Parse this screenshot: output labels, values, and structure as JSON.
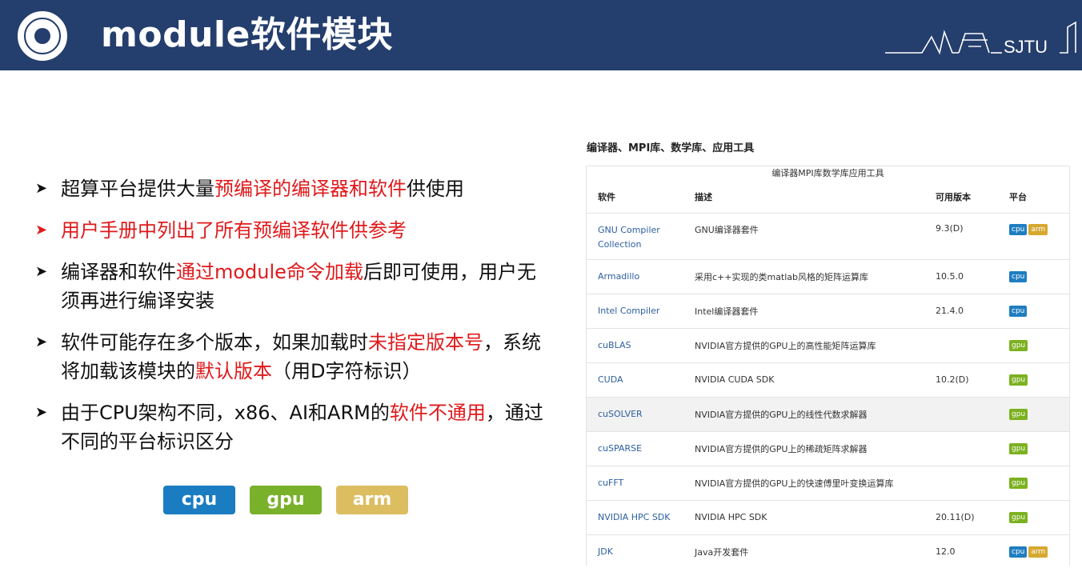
{
  "header": {
    "title": "module软件模块",
    "brand_text": "SJTU"
  },
  "bullets": [
    {
      "parts": [
        "超算平台提供大量",
        "预编译的编译器和软件",
        "供使用"
      ],
      "red": [
        false,
        true,
        false
      ]
    },
    {
      "parts": [
        "用户手册",
        "中列出了所有预编译软件供参考"
      ],
      "red": [
        true,
        false
      ]
    },
    {
      "parts": [
        "编译器和软件",
        "通过module命令加载",
        "后即可使用，用户无须再进行编译安装"
      ],
      "red": [
        false,
        true,
        false
      ]
    },
    {
      "parts": [
        "软件可能存在多个版本，如果加载时",
        "未指定版本号",
        "，系统将加载该模块的",
        "默认版本",
        "（用D字符标识）"
      ],
      "red": [
        false,
        true,
        false,
        true,
        false
      ]
    },
    {
      "parts": [
        "由于CPU架构不同，x86、AI和ARM的",
        "软件不通用",
        "，通过不同的平台标识区分"
      ],
      "red": [
        false,
        true,
        false
      ]
    }
  ],
  "platform_badges": [
    {
      "label": "cpu",
      "color": "#1a7cc1"
    },
    {
      "label": "gpu",
      "color": "#7ab12a"
    },
    {
      "label": "arm",
      "color": "#dcbd60"
    }
  ],
  "panel": {
    "heading": "编译器、MPI库、数学库、应用工具",
    "caption": "编译器MPI库数学库应用工具",
    "columns": [
      "软件",
      "描述",
      "可用版本",
      "平台"
    ],
    "rows": [
      {
        "name": "GNU Compiler Collection",
        "desc": "GNU编译器套件",
        "version": "9.3(D)",
        "tags": [
          "cpu",
          "arm"
        ]
      },
      {
        "name": "Armadillo",
        "desc": "采用c++实现的类matlab风格的矩阵运算库",
        "version": "10.5.0",
        "tags": [
          "cpu"
        ]
      },
      {
        "name": "Intel Compiler",
        "desc": "Intel编译器套件",
        "version": "21.4.0",
        "tags": [
          "cpu"
        ]
      },
      {
        "name": "cuBLAS",
        "desc": "NVIDIA官方提供的GPU上的高性能矩阵运算库",
        "version": "",
        "tags": [
          "gpu"
        ]
      },
      {
        "name": "CUDA",
        "desc": "NVIDIA CUDA SDK",
        "version": "10.2(D)",
        "tags": [
          "gpu"
        ]
      },
      {
        "name": "cuSOLVER",
        "desc": "NVIDIA官方提供的GPU上的线性代数求解器",
        "version": "",
        "tags": [
          "gpu"
        ]
      },
      {
        "name": "cuSPARSE",
        "desc": "NVIDIA官方提供的GPU上的稀疏矩阵求解器",
        "version": "",
        "tags": [
          "gpu"
        ]
      },
      {
        "name": "cuFFT",
        "desc": "NVIDIA官方提供的GPU上的快速傅里叶变换运算库",
        "version": "",
        "tags": [
          "gpu"
        ]
      },
      {
        "name": "NVIDIA HPC SDK",
        "desc": "NVIDIA HPC SDK",
        "version": "20.11(D)",
        "tags": [
          "gpu"
        ]
      },
      {
        "name": "JDK",
        "desc": "Java开发套件",
        "version": "12.0",
        "tags": [
          "cpu",
          "arm"
        ]
      }
    ]
  }
}
